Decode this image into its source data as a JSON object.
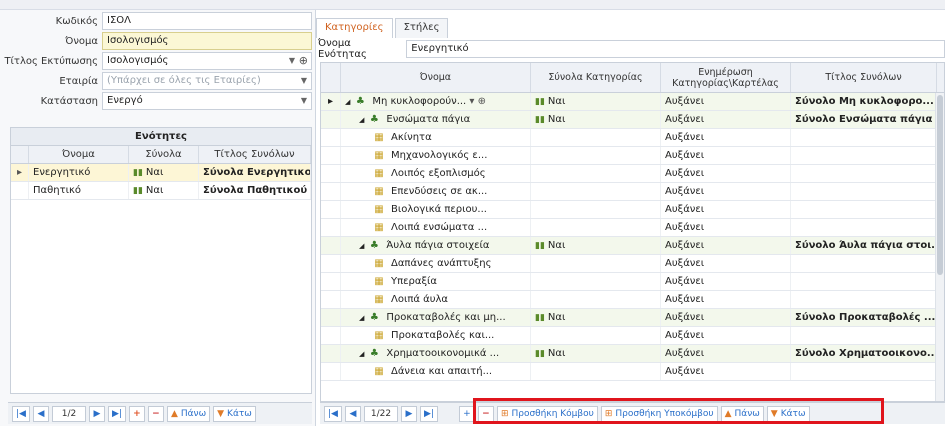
{
  "form": {
    "code_label": "Κωδικός",
    "code_value": "ΙΣΟΛ",
    "name_label": "Όνομα",
    "name_value": "Ισολογισμός",
    "print_title_label": "Τίτλος Εκτύπωσης",
    "print_title_value": "Ισολογισμός",
    "company_label": "Εταιρία",
    "company_placeholder": "(Υπάρχει σε όλες τις Εταιρίες)",
    "status_label": "Κατάσταση",
    "status_value": "Ενεργό"
  },
  "units_grid": {
    "title": "Ενότητες",
    "columns": [
      "Όνομα",
      "Σύνολα",
      "Τίτλος Συνόλων"
    ],
    "rows": [
      {
        "name": "Ενεργητικό",
        "totals": "Ναι",
        "title": "Σύνολα Ενεργητικού"
      },
      {
        "name": "Παθητικό",
        "totals": "Ναι",
        "title": "Σύνολα Παθητικού"
      }
    ]
  },
  "left_nav": {
    "page": "1/2",
    "up": "Πάνω",
    "down": "Κάτω"
  },
  "tabs": [
    "Κατηγορίες",
    "Στήλες"
  ],
  "unit_name_label": "Όνομα Ενότητας",
  "unit_name_value": "Ενεργητικό",
  "cat_grid": {
    "columns": [
      "Όνομα",
      "Σύνολα Κατηγορίας",
      "Ενημέρωση Κατηγορίας\\Καρτέλας",
      "Τίτλος Συνόλων"
    ],
    "rows": [
      {
        "name": "Μη κυκλοφορούν...",
        "totals": "Ναι",
        "update": "Αυξάνει",
        "title": "Σύνολο Μη κυκλοφορο..."
      },
      {
        "name": "Ενσώματα πάγια",
        "totals": "Ναι",
        "update": "Αυξάνει",
        "title": "Σύνολο Ενσώματα πάγια"
      },
      {
        "name": "Ακίνητα",
        "totals": "",
        "update": "Αυξάνει",
        "title": ""
      },
      {
        "name": "Μηχανολογικός ε...",
        "totals": "",
        "update": "Αυξάνει",
        "title": ""
      },
      {
        "name": "Λοιπός εξοπλισμός",
        "totals": "",
        "update": "Αυξάνει",
        "title": ""
      },
      {
        "name": "Επενδύσεις σε ακ...",
        "totals": "",
        "update": "Αυξάνει",
        "title": ""
      },
      {
        "name": "Βιολογικά περιου...",
        "totals": "",
        "update": "Αυξάνει",
        "title": ""
      },
      {
        "name": "Λοιπά ενσώματα ...",
        "totals": "",
        "update": "Αυξάνει",
        "title": ""
      },
      {
        "name": "Άυλα πάγια στοιχεία",
        "totals": "Ναι",
        "update": "Αυξάνει",
        "title": "Σύνολο Άυλα πάγια στοι..."
      },
      {
        "name": "Δαπάνες ανάπτυξης",
        "totals": "",
        "update": "Αυξάνει",
        "title": ""
      },
      {
        "name": "Υπεραξία",
        "totals": "",
        "update": "Αυξάνει",
        "title": ""
      },
      {
        "name": "Λοιπά άυλα",
        "totals": "",
        "update": "Αυξάνει",
        "title": ""
      },
      {
        "name": "Προκαταβολές και μη...",
        "totals": "Ναι",
        "update": "Αυξάνει",
        "title": "Σύνολο Προκαταβολές ..."
      },
      {
        "name": "Προκαταβολές και...",
        "totals": "",
        "update": "Αυξάνει",
        "title": ""
      },
      {
        "name": "Χρηματοοικονομικά ...",
        "totals": "Ναι",
        "update": "Αυξάνει",
        "title": "Σύνολο Χρηματοοικονο..."
      },
      {
        "name": "Δάνεια και απαιτή...",
        "totals": "",
        "update": "Αυξάνει",
        "title": ""
      }
    ]
  },
  "right_nav": {
    "page": "1/22",
    "add_node": "Προσθήκη Κόμβου",
    "add_subnode": "Προσθήκη Υποκόμβου",
    "up": "Πάνω",
    "down": "Κάτω"
  }
}
